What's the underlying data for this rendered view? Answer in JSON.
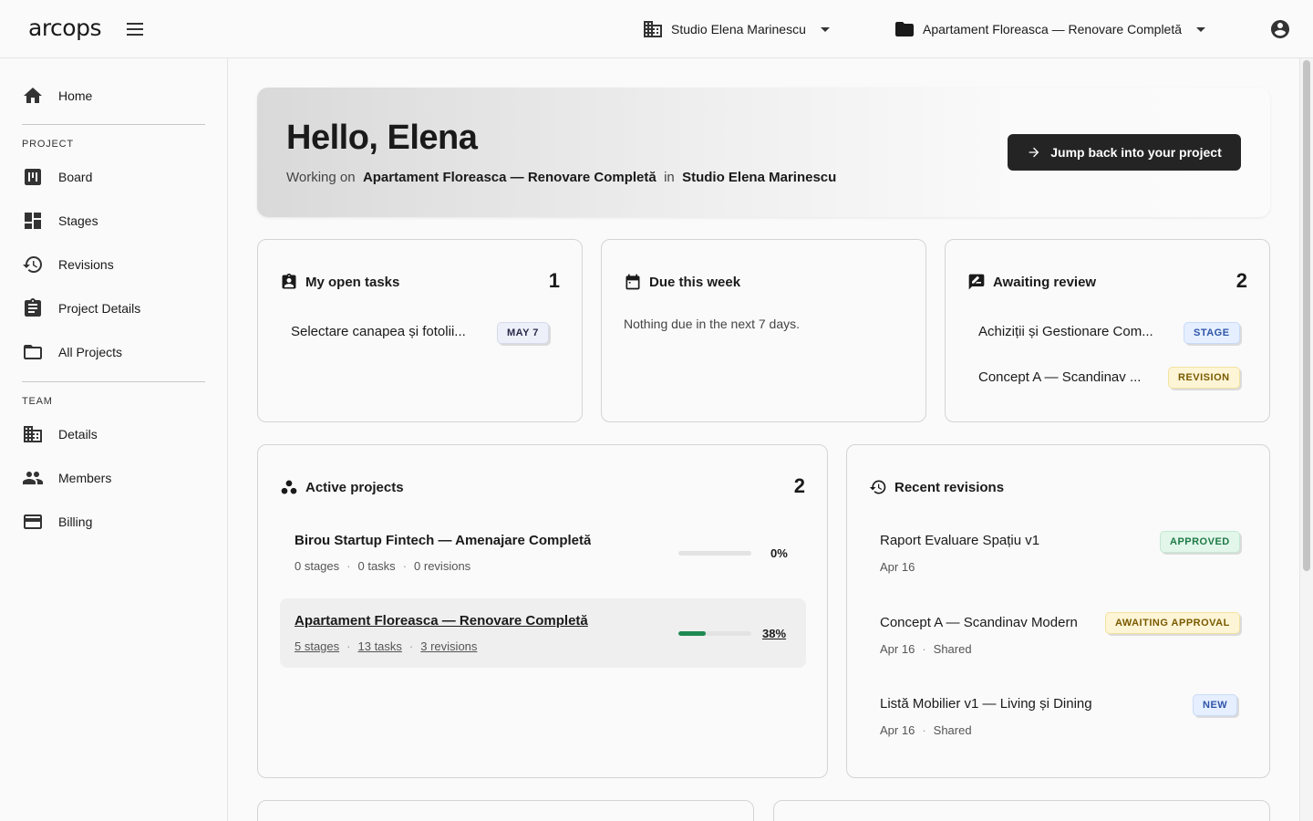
{
  "app": {
    "logo": "arcops"
  },
  "topbar": {
    "team": "Studio Elena Marinescu",
    "project": "Apartament Floreasca — Renovare Completă"
  },
  "sidebar": {
    "home": "Home",
    "project_section": "PROJECT",
    "project_items": [
      "Board",
      "Stages",
      "Revisions",
      "Project Details",
      "All Projects"
    ],
    "team_section": "TEAM",
    "team_items": [
      "Details",
      "Members",
      "Billing"
    ]
  },
  "hero": {
    "greeting": "Hello, Elena",
    "working_on": "Working on",
    "project": "Apartament Floreasca — Renovare Completă",
    "in_label": "in",
    "team": "Studio Elena Marinescu",
    "cta": "Jump back into your project"
  },
  "open_tasks": {
    "title": "My open tasks",
    "count": "1",
    "items": [
      {
        "name": "Selectare canapea și fotolii...",
        "badge": "MAY 7"
      }
    ]
  },
  "due_week": {
    "title": "Due this week",
    "empty": "Nothing due in the next 7 days."
  },
  "awaiting_review": {
    "title": "Awaiting review",
    "count": "2",
    "items": [
      {
        "name": "Achiziții și Gestionare Com...",
        "badge": "STAGE",
        "badge_color": "#2f55a8"
      },
      {
        "name": "Concept A — Scandinav ...",
        "badge": "REVISION",
        "badge_color": "#7a5a00"
      }
    ]
  },
  "active_projects": {
    "title": "Active projects",
    "count": "2",
    "items": [
      {
        "name": "Birou Startup Fintech — Amenajare Completă",
        "stages": "0 stages",
        "tasks": "0 tasks",
        "revisions": "0 revisions",
        "progress_pct": "0%",
        "progress": 0
      },
      {
        "name": "Apartament Floreasca — Renovare Completă",
        "stages": "5 stages",
        "tasks": "13 tasks",
        "revisions": "3 revisions",
        "progress_pct": "38%",
        "progress": 0.38
      }
    ],
    "progress_color": "#1e8a52"
  },
  "recent_revisions": {
    "title": "Recent revisions",
    "shared_label": "Shared",
    "items": [
      {
        "name": "Raport Evaluare Spațiu v1",
        "date": "Apr 16",
        "shared": "",
        "badge": "APPROVED",
        "badge_color": "#1e7a46"
      },
      {
        "name": "Concept A — Scandinav Modern",
        "date": "Apr 16",
        "shared": "Shared",
        "badge": "AWAITING APPROVAL",
        "badge_color": "#7a5a00"
      },
      {
        "name": "Listă Mobilier v1 — Living și Dining",
        "date": "Apr 16",
        "shared": "Shared",
        "badge": "NEW",
        "badge_color": "#2f55a8"
      }
    ]
  }
}
